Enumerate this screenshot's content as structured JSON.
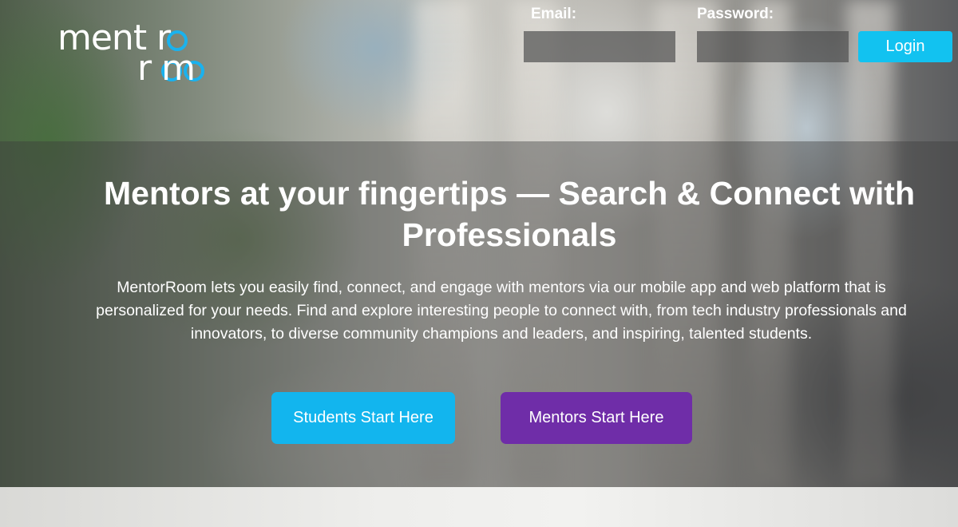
{
  "logo": {
    "line1": "ment r",
    "line2": "r  m"
  },
  "login": {
    "email_label": "Email:",
    "email_value": "",
    "password_label": "Password:",
    "password_value": "",
    "button_label": "Login"
  },
  "hero": {
    "title": "Mentors at your fingertips — Search & Connect with Professionals",
    "description": "MentorRoom lets you easily find, connect, and engage with mentors via our mobile app and web platform that is personalized for your needs. Find and explore interesting people to connect with, from tech industry professionals and innovators, to diverse community champions and leaders, and inspiring, talented students."
  },
  "cta": {
    "students_label": "Students Start Here",
    "mentors_label": "Mentors Start Here"
  },
  "colors": {
    "accent_cyan": "#12c2f0",
    "logo_ring_blue": "#1ab2ee",
    "mentors_purple": "#6f2da8",
    "text_white": "#ffffff"
  }
}
